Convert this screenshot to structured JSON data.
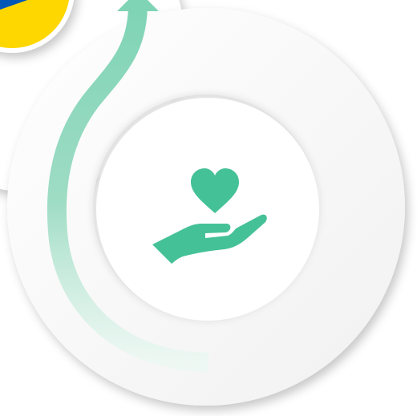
{
  "colors": {
    "accent": "#45c198",
    "arrow_gradient_top": "#7fd4b6",
    "arrow_gradient_bottom": "#eaf8f2",
    "ring": "#f8f8f8",
    "ring_inner": "#ffffff",
    "ukraine_blue": "#0057b7",
    "ukraine_yellow": "#ffd700"
  },
  "icons": {
    "center": "heart-in-hand-icon",
    "arrow": "upward-arrow-icon",
    "flag": "ukraine-flag-icon"
  }
}
